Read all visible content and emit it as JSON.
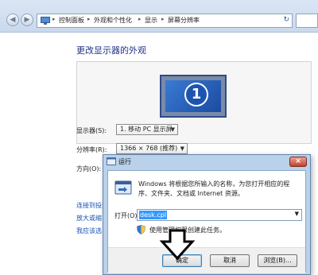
{
  "explorer": {
    "breadcrumb": [
      "控制面板",
      "外观和个性化",
      "显示",
      "屏幕分辨率"
    ],
    "title": "更改显示器的外观",
    "monitor_number": "1",
    "display_label": "显示器(S):",
    "display_value": "1. 移动 PC 显示屏",
    "resolution_label": "分辨率(R):",
    "resolution_value": "1366 × 768 (推荐)",
    "orientation_label": "方向(O):",
    "links": [
      "连接到投影",
      "放大或缩",
      "我应该选"
    ]
  },
  "run_dialog": {
    "title": "运行",
    "close_label": "×",
    "description": "Windows 将根据您所输入的名称，为您打开相应的程序、文件夹、文档或 Internet 资源。",
    "open_label": "打开(O):",
    "open_value": "desk.cpl",
    "admin_text": "使用管理权限创建此任务。",
    "ok_label": "确定",
    "cancel_label": "取消",
    "browse_label": "浏览(B)..."
  },
  "colors": {
    "link": "#1a54b8",
    "title": "#1e3287",
    "dialog_frame": "#b9d1ea",
    "selection": "#3399ff"
  },
  "icons": [
    "back-arrow-icon",
    "forward-arrow-icon",
    "control-panel-icon",
    "refresh-icon",
    "monitor-icon",
    "run-program-icon",
    "shield-icon",
    "down-arrow-pointer-icon"
  ]
}
